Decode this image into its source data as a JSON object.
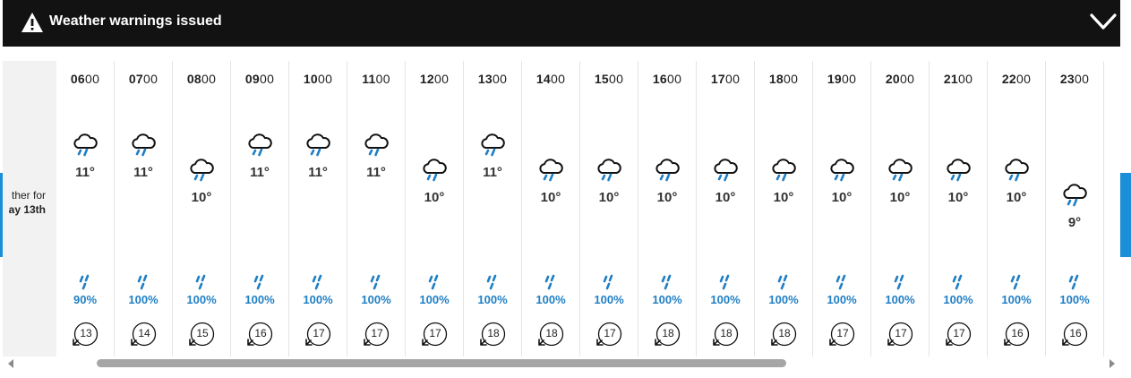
{
  "warning": {
    "text": "Weather warnings issued",
    "icon": "warning-triangle-icon",
    "toggle_icon": "chevron-down-icon"
  },
  "side": {
    "line1": "ther for",
    "line2": "ay 13th",
    "accent_color": "#1a8fd8"
  },
  "colors": {
    "rain": "#1f7fc4",
    "bar": "#121212"
  },
  "hours": [
    {
      "time_bold": "06",
      "time_rest": "00",
      "temp": "11°",
      "precip": "90%",
      "wind": "13"
    },
    {
      "time_bold": "07",
      "time_rest": "00",
      "temp": "11°",
      "precip": "100%",
      "wind": "14"
    },
    {
      "time_bold": "08",
      "time_rest": "00",
      "temp": "10°",
      "precip": "100%",
      "wind": "15"
    },
    {
      "time_bold": "09",
      "time_rest": "00",
      "temp": "11°",
      "precip": "100%",
      "wind": "16"
    },
    {
      "time_bold": "10",
      "time_rest": "00",
      "temp": "11°",
      "precip": "100%",
      "wind": "17"
    },
    {
      "time_bold": "11",
      "time_rest": "00",
      "temp": "11°",
      "precip": "100%",
      "wind": "17"
    },
    {
      "time_bold": "12",
      "time_rest": "00",
      "temp": "10°",
      "precip": "100%",
      "wind": "17"
    },
    {
      "time_bold": "13",
      "time_rest": "00",
      "temp": "11°",
      "precip": "100%",
      "wind": "18"
    },
    {
      "time_bold": "14",
      "time_rest": "00",
      "temp": "10°",
      "precip": "100%",
      "wind": "18"
    },
    {
      "time_bold": "15",
      "time_rest": "00",
      "temp": "10°",
      "precip": "100%",
      "wind": "17"
    },
    {
      "time_bold": "16",
      "time_rest": "00",
      "temp": "10°",
      "precip": "100%",
      "wind": "18"
    },
    {
      "time_bold": "17",
      "time_rest": "00",
      "temp": "10°",
      "precip": "100%",
      "wind": "18"
    },
    {
      "time_bold": "18",
      "time_rest": "00",
      "temp": "10°",
      "precip": "100%",
      "wind": "18"
    },
    {
      "time_bold": "19",
      "time_rest": "00",
      "temp": "10°",
      "precip": "100%",
      "wind": "17"
    },
    {
      "time_bold": "20",
      "time_rest": "00",
      "temp": "10°",
      "precip": "100%",
      "wind": "17"
    },
    {
      "time_bold": "21",
      "time_rest": "00",
      "temp": "10°",
      "precip": "100%",
      "wind": "17"
    },
    {
      "time_bold": "22",
      "time_rest": "00",
      "temp": "10°",
      "precip": "100%",
      "wind": "16"
    },
    {
      "time_bold": "23",
      "time_rest": "00",
      "temp": "9°",
      "precip": "100%",
      "wind": "16"
    }
  ]
}
